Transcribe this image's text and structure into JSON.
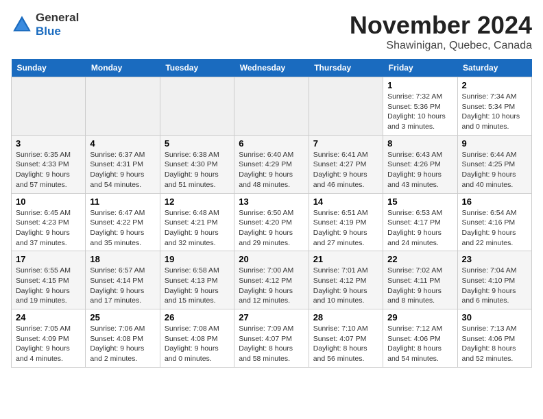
{
  "logo": {
    "general": "General",
    "blue": "Blue"
  },
  "title": "November 2024",
  "location": "Shawinigan, Quebec, Canada",
  "weekdays": [
    "Sunday",
    "Monday",
    "Tuesday",
    "Wednesday",
    "Thursday",
    "Friday",
    "Saturday"
  ],
  "weeks": [
    [
      {
        "day": "",
        "info": ""
      },
      {
        "day": "",
        "info": ""
      },
      {
        "day": "",
        "info": ""
      },
      {
        "day": "",
        "info": ""
      },
      {
        "day": "",
        "info": ""
      },
      {
        "day": "1",
        "info": "Sunrise: 7:32 AM\nSunset: 5:36 PM\nDaylight: 10 hours and 3 minutes."
      },
      {
        "day": "2",
        "info": "Sunrise: 7:34 AM\nSunset: 5:34 PM\nDaylight: 10 hours and 0 minutes."
      }
    ],
    [
      {
        "day": "3",
        "info": "Sunrise: 6:35 AM\nSunset: 4:33 PM\nDaylight: 9 hours and 57 minutes."
      },
      {
        "day": "4",
        "info": "Sunrise: 6:37 AM\nSunset: 4:31 PM\nDaylight: 9 hours and 54 minutes."
      },
      {
        "day": "5",
        "info": "Sunrise: 6:38 AM\nSunset: 4:30 PM\nDaylight: 9 hours and 51 minutes."
      },
      {
        "day": "6",
        "info": "Sunrise: 6:40 AM\nSunset: 4:29 PM\nDaylight: 9 hours and 48 minutes."
      },
      {
        "day": "7",
        "info": "Sunrise: 6:41 AM\nSunset: 4:27 PM\nDaylight: 9 hours and 46 minutes."
      },
      {
        "day": "8",
        "info": "Sunrise: 6:43 AM\nSunset: 4:26 PM\nDaylight: 9 hours and 43 minutes."
      },
      {
        "day": "9",
        "info": "Sunrise: 6:44 AM\nSunset: 4:25 PM\nDaylight: 9 hours and 40 minutes."
      }
    ],
    [
      {
        "day": "10",
        "info": "Sunrise: 6:45 AM\nSunset: 4:23 PM\nDaylight: 9 hours and 37 minutes."
      },
      {
        "day": "11",
        "info": "Sunrise: 6:47 AM\nSunset: 4:22 PM\nDaylight: 9 hours and 35 minutes."
      },
      {
        "day": "12",
        "info": "Sunrise: 6:48 AM\nSunset: 4:21 PM\nDaylight: 9 hours and 32 minutes."
      },
      {
        "day": "13",
        "info": "Sunrise: 6:50 AM\nSunset: 4:20 PM\nDaylight: 9 hours and 29 minutes."
      },
      {
        "day": "14",
        "info": "Sunrise: 6:51 AM\nSunset: 4:19 PM\nDaylight: 9 hours and 27 minutes."
      },
      {
        "day": "15",
        "info": "Sunrise: 6:53 AM\nSunset: 4:17 PM\nDaylight: 9 hours and 24 minutes."
      },
      {
        "day": "16",
        "info": "Sunrise: 6:54 AM\nSunset: 4:16 PM\nDaylight: 9 hours and 22 minutes."
      }
    ],
    [
      {
        "day": "17",
        "info": "Sunrise: 6:55 AM\nSunset: 4:15 PM\nDaylight: 9 hours and 19 minutes."
      },
      {
        "day": "18",
        "info": "Sunrise: 6:57 AM\nSunset: 4:14 PM\nDaylight: 9 hours and 17 minutes."
      },
      {
        "day": "19",
        "info": "Sunrise: 6:58 AM\nSunset: 4:13 PM\nDaylight: 9 hours and 15 minutes."
      },
      {
        "day": "20",
        "info": "Sunrise: 7:00 AM\nSunset: 4:12 PM\nDaylight: 9 hours and 12 minutes."
      },
      {
        "day": "21",
        "info": "Sunrise: 7:01 AM\nSunset: 4:12 PM\nDaylight: 9 hours and 10 minutes."
      },
      {
        "day": "22",
        "info": "Sunrise: 7:02 AM\nSunset: 4:11 PM\nDaylight: 9 hours and 8 minutes."
      },
      {
        "day": "23",
        "info": "Sunrise: 7:04 AM\nSunset: 4:10 PM\nDaylight: 9 hours and 6 minutes."
      }
    ],
    [
      {
        "day": "24",
        "info": "Sunrise: 7:05 AM\nSunset: 4:09 PM\nDaylight: 9 hours and 4 minutes."
      },
      {
        "day": "25",
        "info": "Sunrise: 7:06 AM\nSunset: 4:08 PM\nDaylight: 9 hours and 2 minutes."
      },
      {
        "day": "26",
        "info": "Sunrise: 7:08 AM\nSunset: 4:08 PM\nDaylight: 9 hours and 0 minutes."
      },
      {
        "day": "27",
        "info": "Sunrise: 7:09 AM\nSunset: 4:07 PM\nDaylight: 8 hours and 58 minutes."
      },
      {
        "day": "28",
        "info": "Sunrise: 7:10 AM\nSunset: 4:07 PM\nDaylight: 8 hours and 56 minutes."
      },
      {
        "day": "29",
        "info": "Sunrise: 7:12 AM\nSunset: 4:06 PM\nDaylight: 8 hours and 54 minutes."
      },
      {
        "day": "30",
        "info": "Sunrise: 7:13 AM\nSunset: 4:06 PM\nDaylight: 8 hours and 52 minutes."
      }
    ]
  ]
}
